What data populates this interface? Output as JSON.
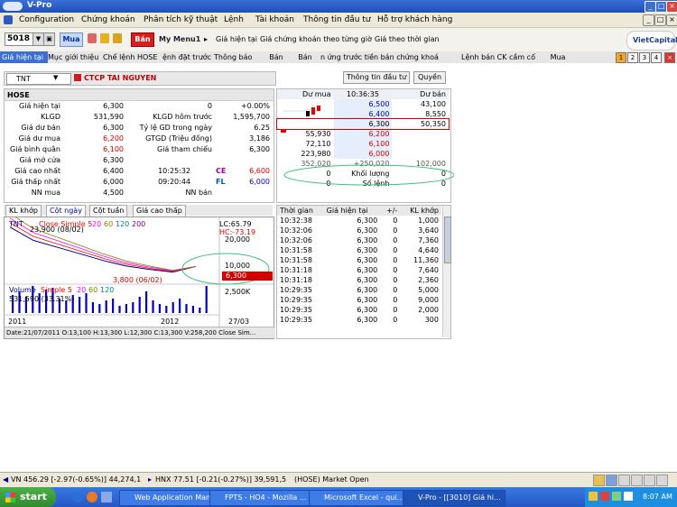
{
  "window": {
    "title": "V-Pro"
  },
  "menu": [
    "Configuration",
    "Chứng khoán",
    "Phân tích kỹ thuật",
    "Lệnh",
    "Tài khoản",
    "Thông tin đầu tư",
    "Hỗ trợ khách hàng"
  ],
  "toolbar": {
    "symbol_code": "5018",
    "buy_label": "Mua",
    "sell_label": "Bán",
    "menu1_label": "My Menu1",
    "links": [
      "Giá hiện tại",
      "Giá chứng khoán theo từng giờ",
      "Giá theo thời gian"
    ],
    "brand": "VietCapital"
  },
  "tabs": [
    "Giá hiện tại",
    "Mục giới thiệu",
    "Chế lệnh HOSE",
    "ệnh đặt trước",
    "Thông báo",
    "Bán",
    "Bán",
    "n ứng trước tiền bán chứng khoá",
    "Lệnh bán CK cầm cố",
    "Mua"
  ],
  "pages": [
    "1",
    "2",
    "3",
    "4"
  ],
  "stock": {
    "ticker": "TNT",
    "name": "CTCP TAI NGUYEN",
    "info_btn": "Thông tin đầu tư",
    "rights_btn": "Quyền",
    "exchange": "HOSE"
  },
  "info_rows": [
    {
      "l1": "Giá hiện tại",
      "v1": "6,300",
      "l2": "0",
      "v2": "+0.00%"
    },
    {
      "l1": "KLGD",
      "v1": "531,590",
      "l2": "KLGD hôm trước",
      "v2": "1,595,700"
    },
    {
      "l1": "Giá dư bán",
      "v1": "6,300",
      "l2": "Tỷ lệ GD trong ngày",
      "v2": "6.25"
    },
    {
      "l1": "Giá dư mua",
      "v1": "6,200",
      "l2": "GTGD (Triệu đồng)",
      "v2": "3,186"
    },
    {
      "l1": "Giá bình quân",
      "v1": "6,100",
      "l2": "Giá tham chiếu",
      "v2": "6,300"
    },
    {
      "l1": "Giá mở cửa",
      "v1": "6,300",
      "l2": "",
      "v2": ""
    },
    {
      "l1": "Giá cao nhất",
      "v1": "6,400",
      "l2": "10:25:32",
      "tag": "CE",
      "v2": "6,600"
    },
    {
      "l1": "Giá thấp nhất",
      "v1": "6,000",
      "l2": "09:20:44",
      "tag": "FL",
      "v2": "6,000"
    },
    {
      "l1": "NN mua",
      "v1": "4,500",
      "l2": "NN bán",
      "v2": ""
    }
  ],
  "orderbook": {
    "headers": [
      "Dư mua",
      "10:36:35",
      "Dư bán"
    ],
    "rows": [
      [
        "",
        "6,500",
        "43,100"
      ],
      [
        "",
        "6,400",
        "8,550"
      ],
      [
        "",
        "6,300",
        "50,350"
      ],
      [
        "55,930",
        "6,200",
        ""
      ],
      [
        "72,110",
        "6,100",
        ""
      ],
      [
        "223,980",
        "6,000",
        ""
      ],
      [
        "352,020",
        "+250,020",
        "102,000"
      ],
      [
        "0",
        "Khối lượng",
        "0"
      ],
      [
        "0",
        "Số lệnh",
        "0"
      ]
    ]
  },
  "chart_tabs": [
    "KL khớp",
    "Cột ngày",
    "Cột tuần",
    "Giá cao thấp"
  ],
  "chart": {
    "legend_ticker": "TNT",
    "legend_ma": "Close Simple 5",
    "legend_periods": [
      "20",
      "60",
      "120",
      "200"
    ],
    "lc": "LC:65.79",
    "hc": "HC:-73.19",
    "high_label": "23,900 (08/02)",
    "low_label": "3,800 (06/02)",
    "y_top": "20,000",
    "y_mid": "10,000",
    "price_tag": "6,300",
    "vol_legend": "Volume",
    "vol_ma": "Simple 5",
    "vol_periods": [
      "20",
      "60",
      "120"
    ],
    "vol_value": "531,590 (33.31%)",
    "vol_scale": "2,500K",
    "x_labels": [
      "2011",
      "2012",
      "27/03"
    ],
    "footer": "Date:21/07/2011 O:13,100 H:13,300 L:12,300 C:13,300 V:258,200 Close Sim...",
    "colors": {
      "close": "#000080",
      "ma5": "#ff0000",
      "ma20": "#ff00ff",
      "ma60": "#808000",
      "volume": "#0000c0",
      "highlight_ellipse": "#40c080"
    }
  },
  "chart_data": [
    {
      "type": "line",
      "title": "TNT",
      "x": [
        "2011",
        "2012",
        "27/03"
      ],
      "series": [
        {
          "name": "Close Simple 5",
          "values": [
            23900,
            18000,
            15000,
            12000,
            9000,
            6500,
            5000,
            3800,
            6300
          ]
        }
      ],
      "ylim": [
        0,
        25000
      ]
    }
  ],
  "trades": {
    "headers": [
      "Thời gian",
      "Giá hiện tại",
      "+/-",
      "KL khớp"
    ],
    "rows": [
      [
        "10:32:38",
        "6,300",
        "0",
        "1,000"
      ],
      [
        "10:32:06",
        "6,300",
        "0",
        "3,640"
      ],
      [
        "10:32:06",
        "6,300",
        "0",
        "7,360"
      ],
      [
        "10:31:58",
        "6,300",
        "0",
        "4,640"
      ],
      [
        "10:31:58",
        "6,300",
        "0",
        "11,360"
      ],
      [
        "10:31:18",
        "6,300",
        "0",
        "7,640"
      ],
      [
        "10:31:18",
        "6,300",
        "0",
        "2,360"
      ],
      [
        "10:29:35",
        "6,300",
        "0",
        "5,000"
      ],
      [
        "10:29:35",
        "6,300",
        "0",
        "9,000"
      ],
      [
        "10:29:35",
        "6,300",
        "0",
        "2,000"
      ],
      [
        "10:29:35",
        "6,300",
        "0",
        "300"
      ]
    ]
  },
  "status": {
    "vn": "VN 456.29 [-2.97(-0.65%)] 44,274,1",
    "hnx": "HNX 77.51 [-0.21(-0.27%)] 39,591,5",
    "market": "(HOSE) Market Open"
  },
  "taskbar": {
    "start": "start",
    "tasks": [
      "Web Application Man...",
      "FPTS - HO4 - Mozilla ...",
      "Microsoft Excel - qui...",
      "V-Pro - [[3010] Giá hi..."
    ],
    "clock": "8:07 AM"
  }
}
